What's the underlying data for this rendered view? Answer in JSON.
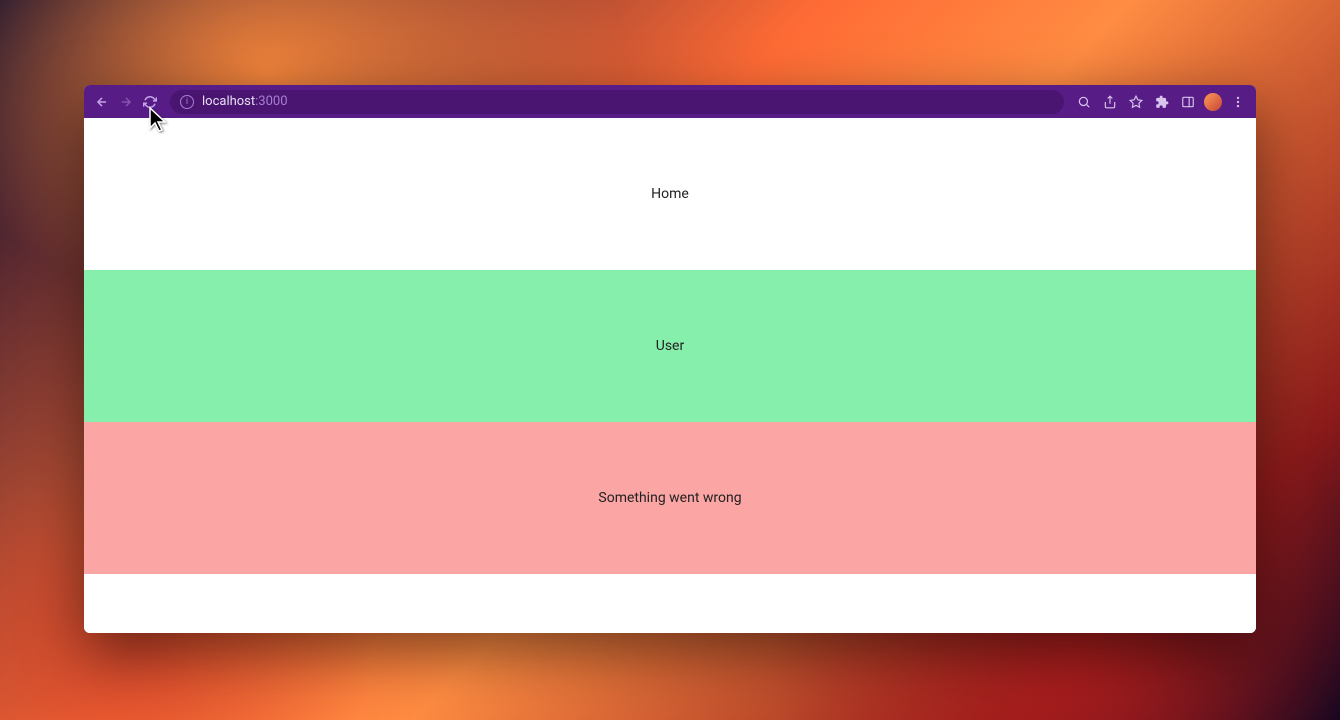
{
  "browser": {
    "url_host": "localhost",
    "url_port": ":3000"
  },
  "sections": [
    {
      "label": "Home",
      "bg": "white"
    },
    {
      "label": "User",
      "bg": "green"
    },
    {
      "label": "Something went wrong",
      "bg": "red"
    }
  ]
}
